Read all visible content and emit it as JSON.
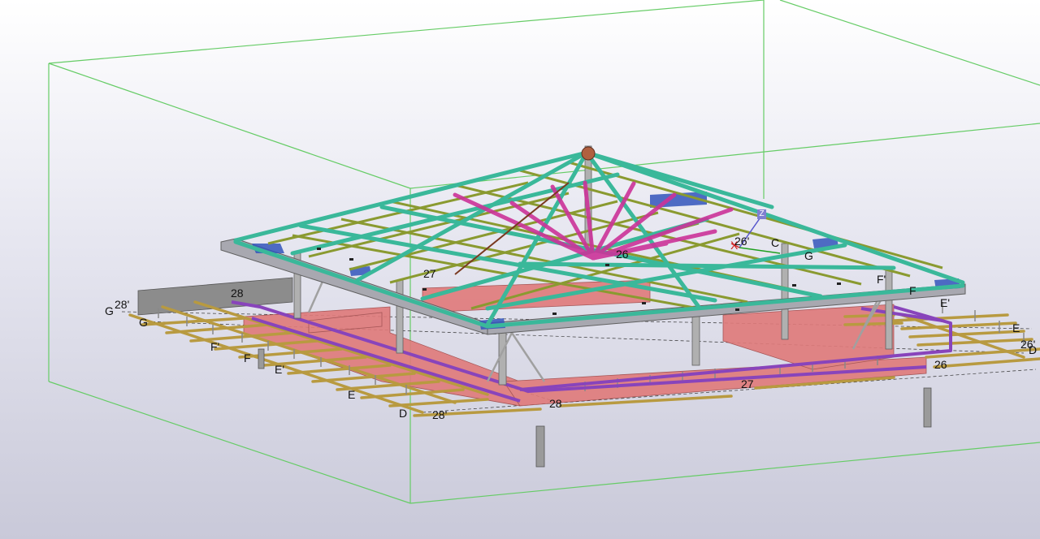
{
  "view": {
    "colors": {
      "background_top": "#ffffff",
      "background_bottom": "#c9c9d9",
      "bounding_box": "#66cc66",
      "roof_rafters": "#3ab89a",
      "roof_purlins": "#8a9a30",
      "diagonal_braces": "#cc3399",
      "columns_beams": "#a0a0a0",
      "slab_plates": "#e07a7a",
      "ring_beam": "#8844bb",
      "floor_joists": "#b89a40",
      "corner_plates": "#3355bb"
    }
  },
  "axis_gizmo": {
    "z_label": "Z",
    "x_label": "X"
  },
  "grid_labels": [
    {
      "id": "g28p-left",
      "text": "28'"
    },
    {
      "id": "G-left",
      "text": "G"
    },
    {
      "id": "G-left-2",
      "text": "G"
    },
    {
      "id": "28-left",
      "text": "28"
    },
    {
      "id": "27-roof",
      "text": "27"
    },
    {
      "id": "26-roof",
      "text": "26"
    },
    {
      "id": "Fp-left",
      "text": "F'"
    },
    {
      "id": "F-left",
      "text": "F"
    },
    {
      "id": "Ep-left",
      "text": "E'"
    },
    {
      "id": "E-left",
      "text": "E"
    },
    {
      "id": "D-left",
      "text": "D"
    },
    {
      "id": "28p-bottom",
      "text": "28'"
    },
    {
      "id": "28-bottom",
      "text": "28"
    },
    {
      "id": "27-bottom",
      "text": "27"
    },
    {
      "id": "26-right",
      "text": "26"
    },
    {
      "id": "26p-right",
      "text": "26'"
    },
    {
      "id": "D-right",
      "text": "D"
    },
    {
      "id": "E-right",
      "text": "E"
    },
    {
      "id": "Ep-right",
      "text": "E'"
    },
    {
      "id": "F-right",
      "text": "F"
    },
    {
      "id": "Fp-right",
      "text": "F'"
    },
    {
      "id": "G-right",
      "text": "G"
    },
    {
      "id": "C-top",
      "text": "C"
    },
    {
      "id": "26p-top",
      "text": "26'"
    }
  ]
}
